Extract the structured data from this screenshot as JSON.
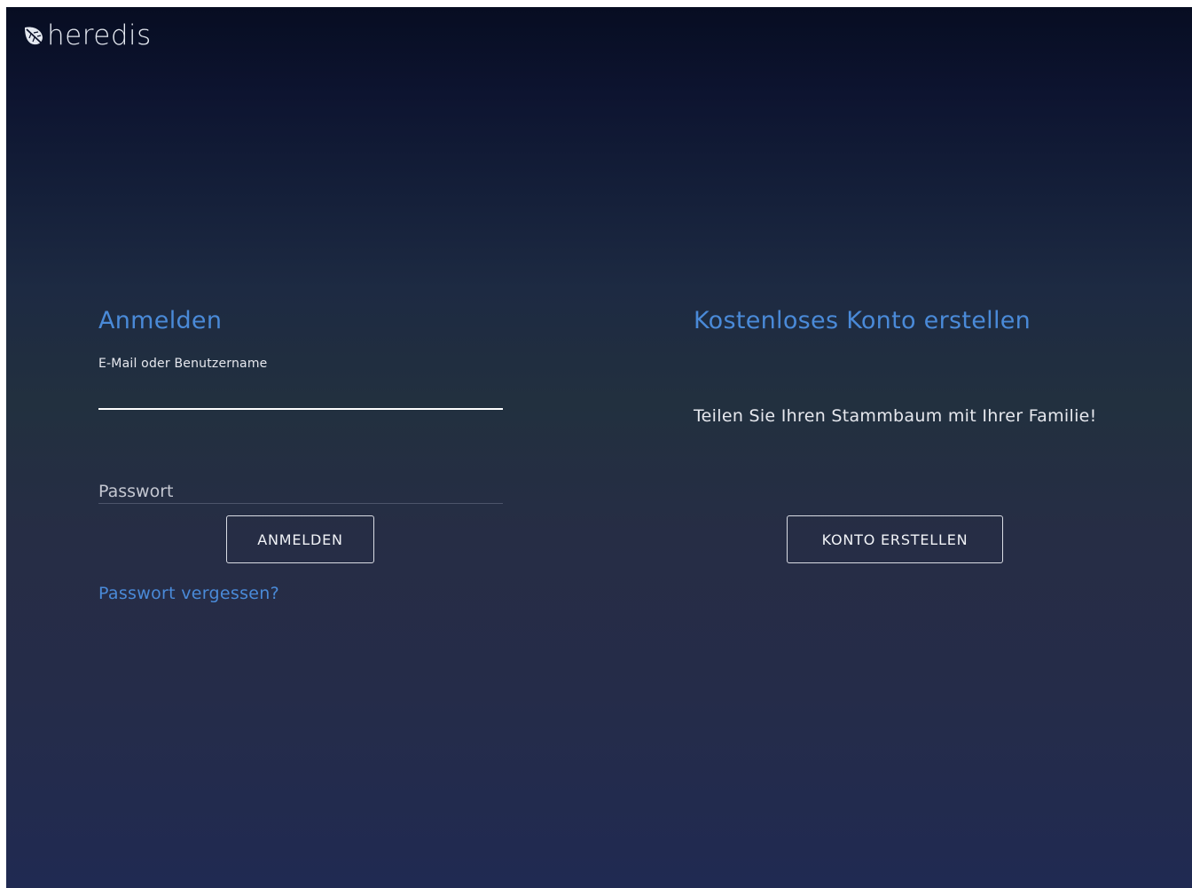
{
  "brand": {
    "logo_text": "heredis",
    "logo_icon": "leaf-icon"
  },
  "login": {
    "title": "Anmelden",
    "email_label": "E-Mail oder Benutzername",
    "email_value": "",
    "password_placeholder": "Passwort",
    "password_value": "",
    "submit_label": "ANMELDEN",
    "forgot_label": "Passwort vergessen?"
  },
  "signup": {
    "title": "Kostenloses Konto erstellen",
    "description": "Teilen Sie Ihren Stammbaum mit Ihrer Familie!",
    "button_label": "KONTO ERSTELLEN"
  },
  "colors": {
    "accent": "#4a8ad8",
    "background_top": "#070d22",
    "background_bottom": "#202a52",
    "text": "#e6e8ee"
  }
}
